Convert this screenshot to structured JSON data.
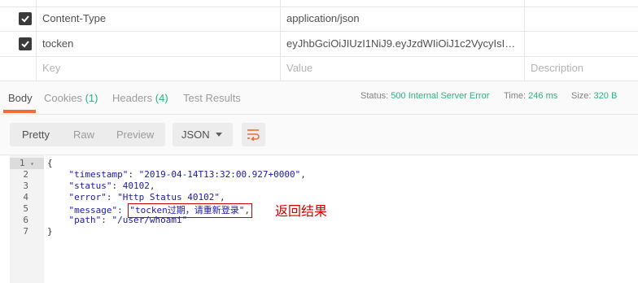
{
  "headers_table": {
    "rows": [
      {
        "checked": true,
        "key": "Content-Type",
        "value": "application/json",
        "description": ""
      },
      {
        "checked": true,
        "key": "tocken",
        "value": "eyJhbGciOiJIUzI1NiJ9.eyJzdWIiOiJ1c2VycyIsImlzcyI...",
        "description": ""
      }
    ],
    "placeholder_row": {
      "key": "Key",
      "value": "Value",
      "description": "Description"
    }
  },
  "response_tabs": [
    {
      "label": "Body",
      "count": "",
      "active": true
    },
    {
      "label": "Cookies",
      "count": "(1)",
      "active": false
    },
    {
      "label": "Headers",
      "count": "(4)",
      "active": false
    },
    {
      "label": "Test Results",
      "count": "",
      "active": false
    }
  ],
  "status_bar": {
    "status_label": "Status:",
    "status_value": "500 Internal Server Error",
    "time_label": "Time:",
    "time_value": "246 ms",
    "size_label": "Size:",
    "size_value": "320 B"
  },
  "format_toolbar": {
    "modes": [
      "Pretty",
      "Raw",
      "Preview"
    ],
    "active_mode": "Pretty",
    "language": "JSON",
    "wrap_icon": "wrap-lines-icon"
  },
  "code": {
    "line_numbers": [
      "1",
      "2",
      "3",
      "4",
      "5",
      "6",
      "7"
    ],
    "lines": [
      {
        "key": "",
        "value": "",
        "raw": "{"
      },
      {
        "key": "\"timestamp\"",
        "value": "\"2019-04-14T13:32:00.927+0000\"",
        "trail": ","
      },
      {
        "key": "\"status\"",
        "value": "40102",
        "trail": ","
      },
      {
        "key": "\"error\"",
        "value": "\"Http Status 40102\"",
        "trail": ","
      },
      {
        "key": "\"message\"",
        "value_prefix": "\"tocken",
        "value_zh": "过期，请重新登录",
        "value_suffix": "\"",
        "trail": ","
      },
      {
        "key": "\"path\"",
        "value": "\"/user/whoami\"",
        "trail": ""
      },
      {
        "key": "",
        "value": "",
        "raw": "}"
      }
    ]
  },
  "annotation": "返回结果",
  "colors": {
    "accent": "#f26b3a",
    "status_green": "#26b47f",
    "annotation_red": "#d00000"
  }
}
